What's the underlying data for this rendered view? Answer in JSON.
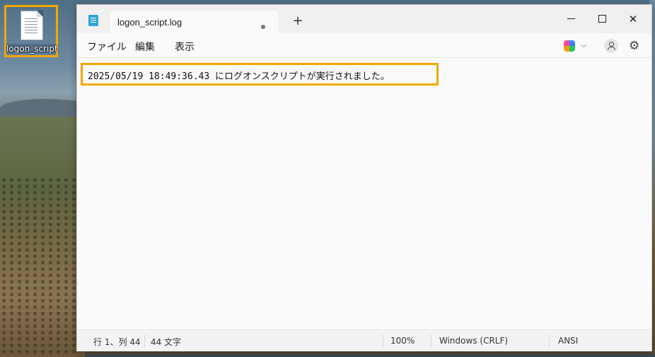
{
  "desktop": {
    "icon_label": "logon_script"
  },
  "window": {
    "tab_title": "logon_script.log",
    "new_tab_symbol": "+",
    "controls": {
      "close": "✕"
    }
  },
  "menu": {
    "file": "ファイル",
    "edit": "編集",
    "view": "表示"
  },
  "toolbar": {
    "chevron": "⌵",
    "gear": "⚙"
  },
  "editor": {
    "content": "2025/05/19 18:49:36.43 にログオンスクリプトが実行されました。"
  },
  "status": {
    "position": "行 1、列 44",
    "chars": "44 文字",
    "zoom": "100%",
    "line_ending": "Windows (CRLF)",
    "encoding": "ANSI"
  },
  "colors": {
    "highlight": "#f4a700",
    "app_icon": "#2fa3d6"
  }
}
